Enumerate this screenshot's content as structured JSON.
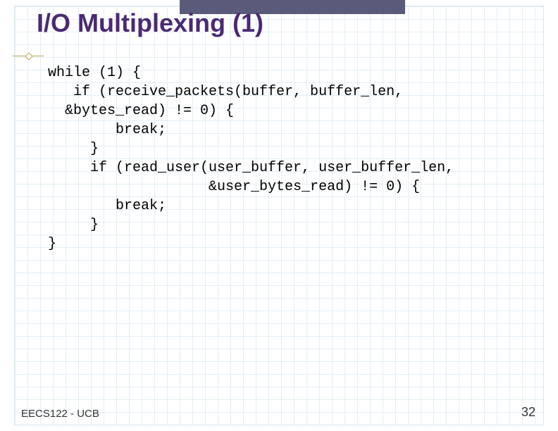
{
  "title": "I/O Multiplexing (1)",
  "code": "while (1) {\n   if (receive_packets(buffer, buffer_len,\n  &bytes_read) != 0) {\n        break;\n     }\n     if (read_user(user_buffer, user_buffer_len,\n                   &user_bytes_read) != 0) {\n        break;\n     }\n}",
  "footer_left": "EECS122 - UCB",
  "footer_right": "32"
}
